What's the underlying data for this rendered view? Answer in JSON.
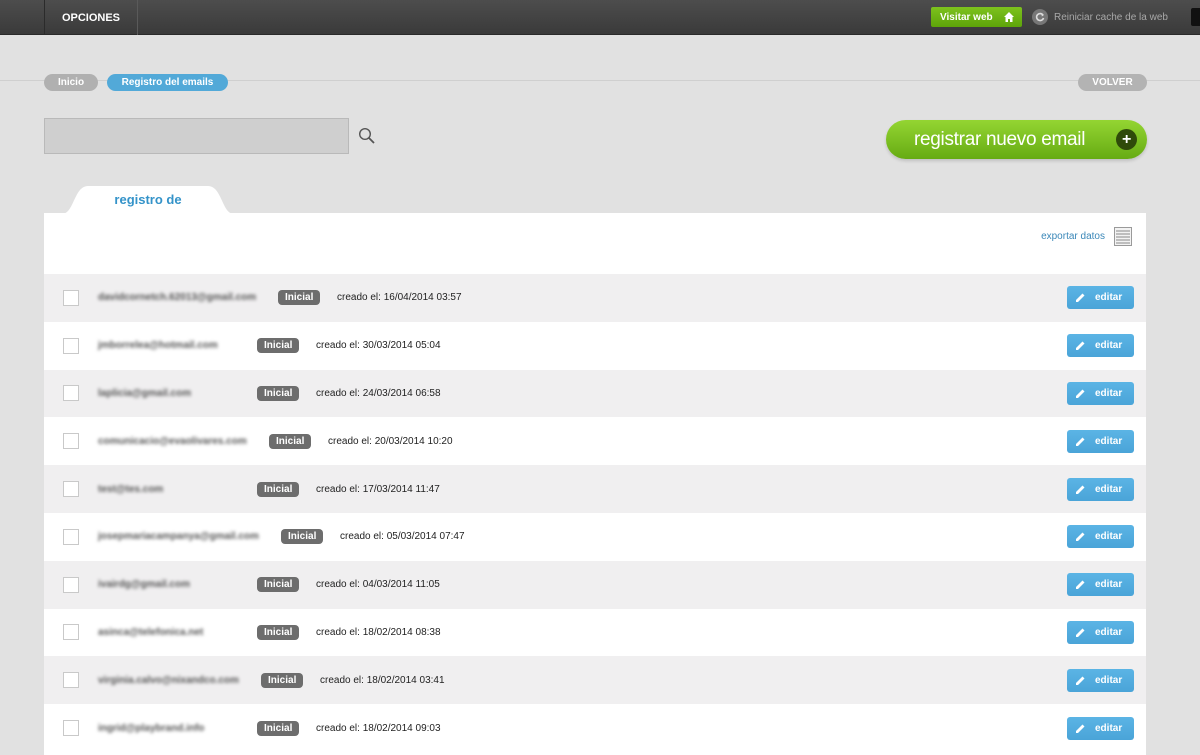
{
  "topbar": {
    "options_label": "OPCIONES",
    "visit_label": "Visitar web",
    "reset_cache_label": "Reiniciar cache de la web"
  },
  "breadcrumb": {
    "home": "Inicio",
    "current": "Registro del emails",
    "back": "VOLVER"
  },
  "search": {
    "value": "",
    "placeholder": ""
  },
  "register_button": "registrar nuevo email",
  "tab_label": "registro de",
  "export_label": "exportar datos",
  "edit_label": "editar",
  "rows": [
    {
      "email": "davidcornetch.62013@gmail.com",
      "status": "Inicial",
      "created": "creado el: 16/04/2014 03:57"
    },
    {
      "email": "jmborrelea@hotmail.com",
      "status": "Inicial",
      "created": "creado el: 30/03/2014 05:04"
    },
    {
      "email": "laplicia@gmail.com",
      "status": "Inicial",
      "created": "creado el: 24/03/2014 06:58"
    },
    {
      "email": "comunicacio@evaolivares.com",
      "status": "Inicial",
      "created": "creado el: 20/03/2014 10:20"
    },
    {
      "email": "test@tes.com",
      "status": "Inicial",
      "created": "creado el: 17/03/2014 11:47"
    },
    {
      "email": "josepmariacampanya@gmail.com",
      "status": "Inicial",
      "created": "creado el: 05/03/2014 07:47"
    },
    {
      "email": "ivairdg@gmail.com",
      "status": "Inicial",
      "created": "creado el: 04/03/2014 11:05"
    },
    {
      "email": "asinca@telefonica.net",
      "status": "Inicial",
      "created": "creado el: 18/02/2014 08:38"
    },
    {
      "email": "virginia.calvo@nixandco.com",
      "status": "Inicial",
      "created": "creado el: 18/02/2014 03:41"
    },
    {
      "email": "ingrid@playbrand.info",
      "status": "Inicial",
      "created": "creado el: 18/02/2014 09:03"
    }
  ]
}
